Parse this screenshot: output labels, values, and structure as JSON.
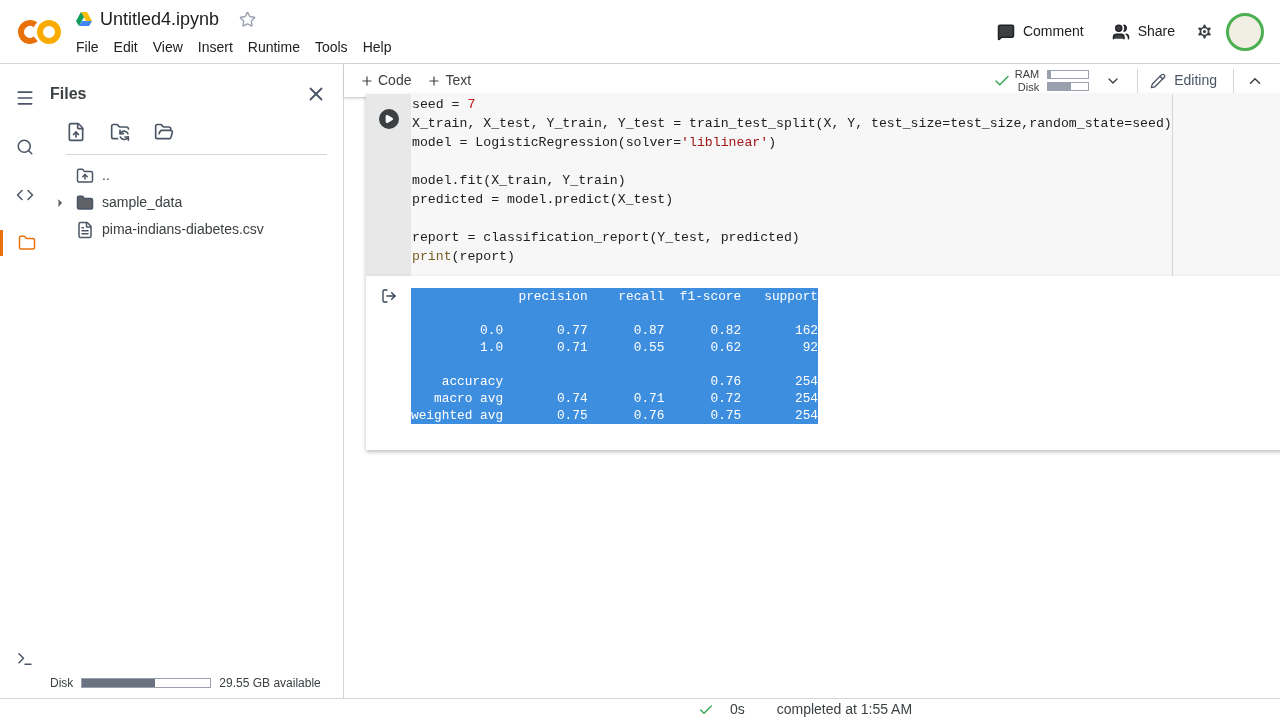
{
  "header": {
    "notebook_title": "Untitled4.ipynb",
    "starred": false,
    "menu": [
      "File",
      "Edit",
      "View",
      "Insert",
      "Runtime",
      "Tools",
      "Help"
    ],
    "actions": [
      {
        "kind": "comment",
        "label": "Comment"
      },
      {
        "kind": "share",
        "label": "Share"
      }
    ]
  },
  "sidebar": {
    "title": "Files",
    "rail": [
      {
        "kind": "toc",
        "selected": false
      },
      {
        "kind": "search",
        "selected": false
      },
      {
        "kind": "code",
        "selected": false
      },
      {
        "kind": "files",
        "selected": true
      }
    ],
    "tree": [
      {
        "kind": "parent",
        "label": "..",
        "expandable": false
      },
      {
        "kind": "folder",
        "label": "sample_data",
        "expandable": true
      },
      {
        "kind": "file",
        "label": "pima-indians-diabetes.csv",
        "expandable": false
      }
    ],
    "disk": {
      "label": "Disk",
      "level": 0.57,
      "reading": "29.55 GB available"
    }
  },
  "toolbar": {
    "add": [
      "Code",
      "Text"
    ],
    "ram": {
      "label": "RAM",
      "level": 0.07
    },
    "disk": {
      "label": "Disk",
      "level": 0.57
    },
    "connected": true,
    "mode": "Editing"
  },
  "cell": {
    "code": [
      {
        "kind": "line",
        "tokens": [
          {
            "text": "seed = ",
            "kind": "plain"
          },
          {
            "text": "7",
            "kind": "number"
          }
        ]
      },
      {
        "kind": "line",
        "tokens": [
          {
            "text": "X_train, X_test, Y_train, Y_test = train_test_split(X, Y, test_size=test_size,random_state=seed)",
            "kind": "plain"
          }
        ]
      },
      {
        "kind": "line",
        "tokens": [
          {
            "text": "model = LogisticRegression(solver=",
            "kind": "plain"
          },
          {
            "text": "'liblinear'",
            "kind": "string"
          },
          {
            "text": ")",
            "kind": "plain"
          }
        ]
      },
      {
        "kind": "blank"
      },
      {
        "kind": "line",
        "tokens": [
          {
            "text": "model.fit(X_train, Y_train)",
            "kind": "plain"
          }
        ]
      },
      {
        "kind": "line",
        "tokens": [
          {
            "text": "predicted = model.predict(X_test)",
            "kind": "plain"
          }
        ]
      },
      {
        "kind": "blank"
      },
      {
        "kind": "line",
        "tokens": [
          {
            "text": "report = classification_report(Y_test, predicted)",
            "kind": "plain"
          }
        ]
      },
      {
        "kind": "line",
        "tokens": [
          {
            "text": "print",
            "kind": "builtin"
          },
          {
            "text": "(report)",
            "kind": "plain"
          }
        ]
      }
    ],
    "output": {
      "selected": true,
      "lines": [
        {
          "kind": "text",
          "text": "              precision    recall  f1-score   support"
        },
        {
          "kind": "blank"
        },
        {
          "kind": "text",
          "text": "         0.0       0.77      0.87      0.82       162"
        },
        {
          "kind": "text",
          "text": "         1.0       0.71      0.55      0.62        92"
        },
        {
          "kind": "blank"
        },
        {
          "kind": "text",
          "text": "    accuracy                           0.76       254"
        },
        {
          "kind": "text",
          "text": "   macro avg       0.74      0.71      0.72       254"
        },
        {
          "kind": "text",
          "text": "weighted avg       0.75      0.76      0.75       254"
        }
      ]
    }
  },
  "status": {
    "done": true,
    "duration": "0s",
    "message": "completed at 1:55 AM"
  }
}
